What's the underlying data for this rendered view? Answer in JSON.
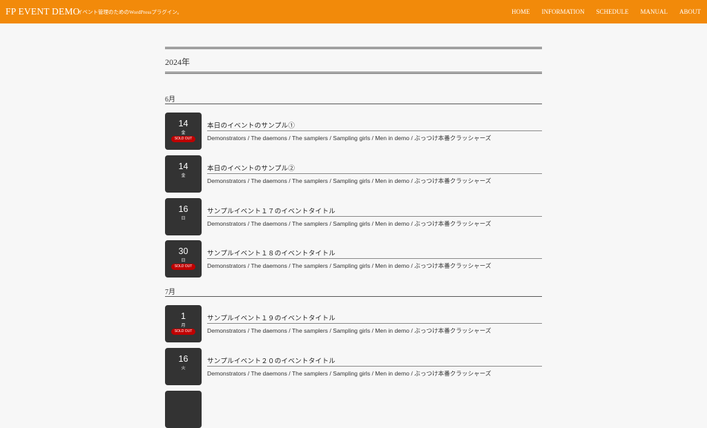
{
  "header": {
    "site_title": "FP EVENT DEMO",
    "site_description": "イベント管理のためのWordPressプラグイン。",
    "nav": [
      "HOME",
      "INFORMATION",
      "SCHEDULE",
      "MANUAL",
      "ABOUT"
    ]
  },
  "year": "2024年",
  "months": [
    "6月",
    "7月"
  ],
  "events": [
    {
      "day": "14",
      "dow": "金",
      "sold_out": "SOLD OUT",
      "title": "本日のイベントのサンプル①",
      "cast": "Demonstrators / The daemons / The samplers / Sampling girls / Men in demo / ぶっつけ本番クラッシャーズ"
    },
    {
      "day": "14",
      "dow": "金",
      "sold_out": "",
      "title": "本日のイベントのサンプル②",
      "cast": "Demonstrators / The daemons / The samplers / Sampling girls / Men in demo / ぶっつけ本番クラッシャーズ"
    },
    {
      "day": "16",
      "dow": "日",
      "sold_out": "",
      "title": "サンプルイベント１７のイベントタイトル",
      "cast": "Demonstrators / The daemons / The samplers / Sampling girls / Men in demo / ぶっつけ本番クラッシャーズ"
    },
    {
      "day": "30",
      "dow": "日",
      "sold_out": "SOLD OUT",
      "title": "サンプルイベント１８のイベントタイトル",
      "cast": "Demonstrators / The daemons / The samplers / Sampling girls / Men in demo / ぶっつけ本番クラッシャーズ"
    },
    {
      "day": "1",
      "dow": "月",
      "sold_out": "SOLD OUT",
      "title": "サンプルイベント１９のイベントタイトル",
      "cast": "Demonstrators / The daemons / The samplers / Sampling girls / Men in demo / ぶっつけ本番クラッシャーズ"
    },
    {
      "day": "16",
      "dow": "火",
      "sold_out": "",
      "title": "サンプルイベント２０のイベントタイトル",
      "cast": "Demonstrators / The daemons / The samplers / Sampling girls / Men in demo / ぶっつけ本番クラッシャーズ"
    }
  ]
}
